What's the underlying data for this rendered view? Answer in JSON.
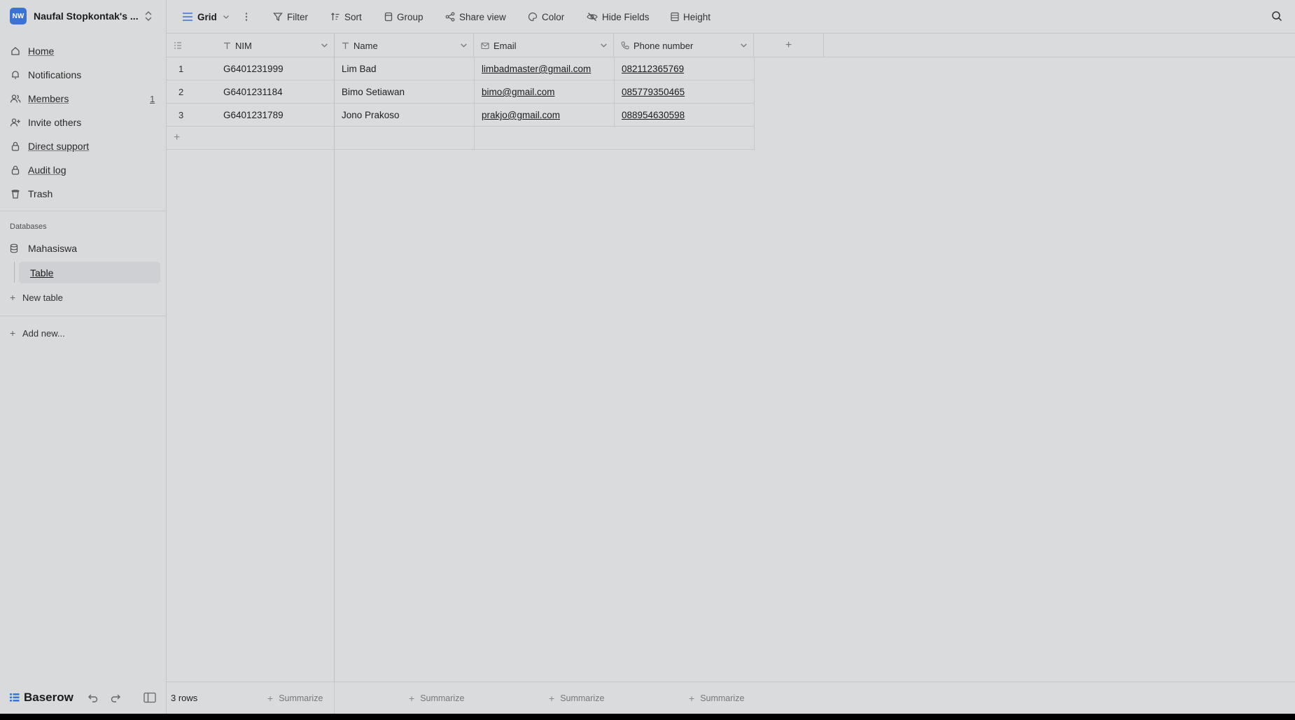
{
  "workspace": {
    "initials": "NW",
    "name": "Naufal Stopkontak's ..."
  },
  "nav": {
    "home": "Home",
    "notifications": "Notifications",
    "members": "Members",
    "members_count": "1",
    "invite": "Invite others",
    "support": "Direct support",
    "audit": "Audit log",
    "trash": "Trash"
  },
  "databases": {
    "section_label": "Databases",
    "db_name": "Mahasiswa",
    "table_name": "Table",
    "new_table": "New table",
    "add_new": "Add new..."
  },
  "brand": {
    "name": "Baserow"
  },
  "toolbar": {
    "view": "Grid",
    "filter": "Filter",
    "sort": "Sort",
    "group": "Group",
    "share": "Share view",
    "color": "Color",
    "hide_fields": "Hide Fields",
    "height": "Height"
  },
  "columns": {
    "nim": "NIM",
    "name": "Name",
    "email": "Email",
    "phone": "Phone number"
  },
  "rows": [
    {
      "num": "1",
      "nim": "G6401231999",
      "name": "Lim Bad",
      "email": "limbadmaster@gmail.com",
      "phone": "082112365769"
    },
    {
      "num": "2",
      "nim": "G6401231184",
      "name": "Bimo Setiawan",
      "email": "bimo@gmail.com",
      "phone": "085779350465"
    },
    {
      "num": "3",
      "nim": "G6401231789",
      "name": "Jono Prakoso",
      "email": "prakjo@gmail.com",
      "phone": "088954630598"
    }
  ],
  "footer": {
    "rows_count": "3 rows",
    "summarize": "Summarize"
  }
}
